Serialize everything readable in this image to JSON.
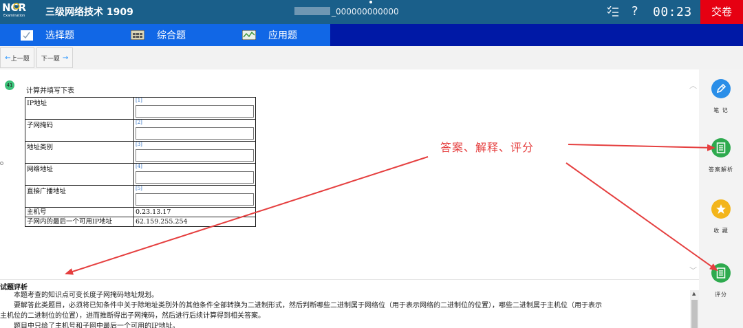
{
  "header": {
    "logo_text": "NCR",
    "logo_sub": "Examination",
    "title": "三级网络技术 1909",
    "account_suffix": "_000000000000",
    "help_glyph": "?",
    "timer": "00:23",
    "submit_label": "交卷"
  },
  "tabs": [
    {
      "label": "选择题"
    },
    {
      "label": "综合题"
    },
    {
      "label": "应用题"
    }
  ],
  "nav": {
    "prev_label": "上一题",
    "next_label": "下一题",
    "prev_arrow": "←",
    "next_arrow": "→"
  },
  "question": {
    "number": "41",
    "prompt": "计算并填写下表",
    "rows": [
      {
        "label": "IP地址",
        "index": "[1]"
      },
      {
        "label": "子网掩码",
        "index": "[2]"
      },
      {
        "label": "地址类别",
        "index": "[3]"
      },
      {
        "label": "网络地址",
        "index": "[4]"
      },
      {
        "label": "直接广播地址",
        "index": "[5]"
      }
    ],
    "given": [
      {
        "label": "主机号",
        "value": "0.23.13.17"
      },
      {
        "label": "子网内的最后一个可用IP地址",
        "value": "62.159.255.254"
      }
    ]
  },
  "annotation": "答案、解释、评分",
  "analysis": {
    "title": "试题评析",
    "lines": [
      "本题考查的知识点可变长度子网掩码地址规划。",
      "要解答此类题目，必须将已知条件中关于除地址类别外的其他条件全部转换为二进制形式，然后判断哪些二进制属于网络位（用于表示网络的二进制位的位置），哪些二进制属于主机位（用于表示",
      "主机位的二进制位的位置），进而推断得出子网掩码，然后进行后续计算得到相关答案。",
      "题目中只给了主机号和子网中最后一个可用的IP地址。"
    ]
  },
  "sidebar": [
    {
      "label": "笔 记",
      "icon": "pencil-icon"
    },
    {
      "label": "答案解析",
      "icon": "document-icon"
    },
    {
      "label": "收 藏",
      "icon": "star-icon"
    },
    {
      "label": "评分",
      "icon": "document-icon"
    }
  ],
  "colors": {
    "header_bg": "#1a5f8a",
    "tab_active_bg": "#1167e6",
    "tab_bar_bg": "#0019a6",
    "submit_bg": "#e60012",
    "annotation": "#e53f3f"
  }
}
